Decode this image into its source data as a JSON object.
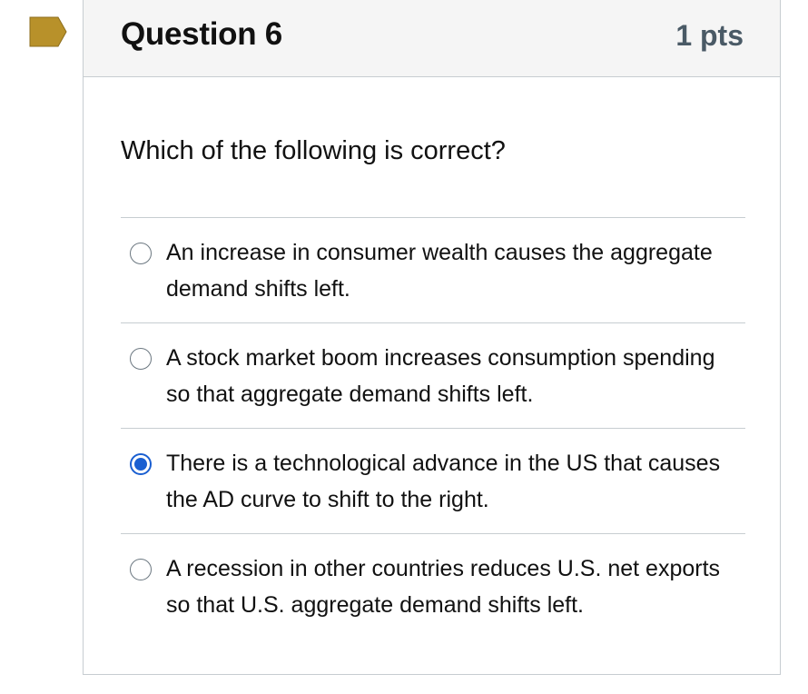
{
  "question": {
    "title": "Question 6",
    "points": "1 pts",
    "prompt": "Which of the following is correct?",
    "flag_color": "#b8912a",
    "answers": [
      {
        "text": "An increase in consumer wealth causes the aggregate demand shifts left.",
        "selected": false
      },
      {
        "text": "A stock market boom increases consumption spending so that aggregate demand shifts left.",
        "selected": false
      },
      {
        "text": "There is a technological advance in the US that causes the AD curve to shift to the right.",
        "selected": true
      },
      {
        "text": "A recession in other countries reduces U.S. net exports so that U.S. aggregate demand shifts left.",
        "selected": false
      }
    ]
  },
  "colors": {
    "radio_selected": "#1a5fd1",
    "header_bg": "#f5f5f5",
    "border": "#c7cdd1"
  }
}
